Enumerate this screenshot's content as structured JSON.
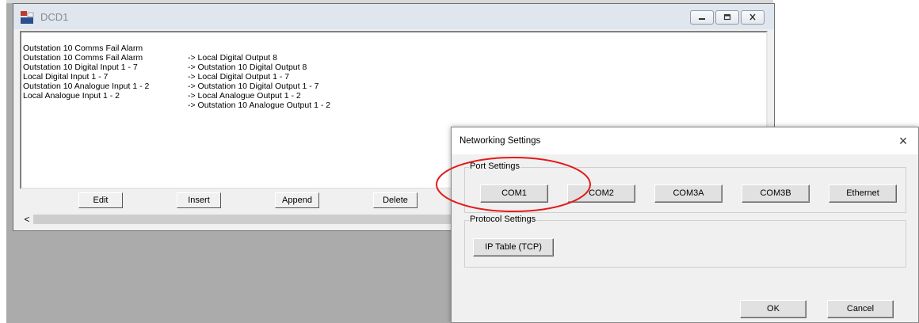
{
  "dcd_window": {
    "title": "DCD1",
    "mappings": [
      {
        "source": "Outstation 10 Comms Fail Alarm",
        "target": "-> Local Digital Output 8"
      },
      {
        "source": "Outstation 10 Comms Fail Alarm",
        "target": "-> Outstation 10 Digital Output 8"
      },
      {
        "source": "Outstation 10 Digital Input 1 - 7",
        "target": "-> Local Digital Output 1 - 7"
      },
      {
        "source": "Local Digital Input 1 - 7",
        "target": "-> Outstation 10 Digital Output 1 - 7"
      },
      {
        "source": "Outstation 10 Analogue Input 1 - 2",
        "target": "-> Local Analogue Output 1 - 2"
      },
      {
        "source": "Local Analogue Input 1 - 2",
        "target": "-> Outstation 10 Analogue Output 1 - 2"
      }
    ],
    "buttons": {
      "edit": "Edit",
      "insert": "Insert",
      "append": "Append",
      "delete": "Delete"
    },
    "scroll_left": "<"
  },
  "networking_dialog": {
    "title": "Networking Settings",
    "close": "×",
    "port_settings": {
      "label": "Port Settings",
      "buttons": [
        "COM1",
        "COM2",
        "COM3A",
        "COM3B",
        "Ethernet"
      ]
    },
    "protocol_settings": {
      "label": "Protocol Settings",
      "ip_table": "IP Table (TCP)"
    },
    "ok": "OK",
    "cancel": "Cancel"
  },
  "colors": {
    "mdi_background": "#ababab",
    "annotation_circle": "#e31b1b"
  },
  "icons": [
    "app-icon",
    "minimize-icon",
    "restore-icon",
    "close-icon",
    "scroll-left-icon"
  ]
}
